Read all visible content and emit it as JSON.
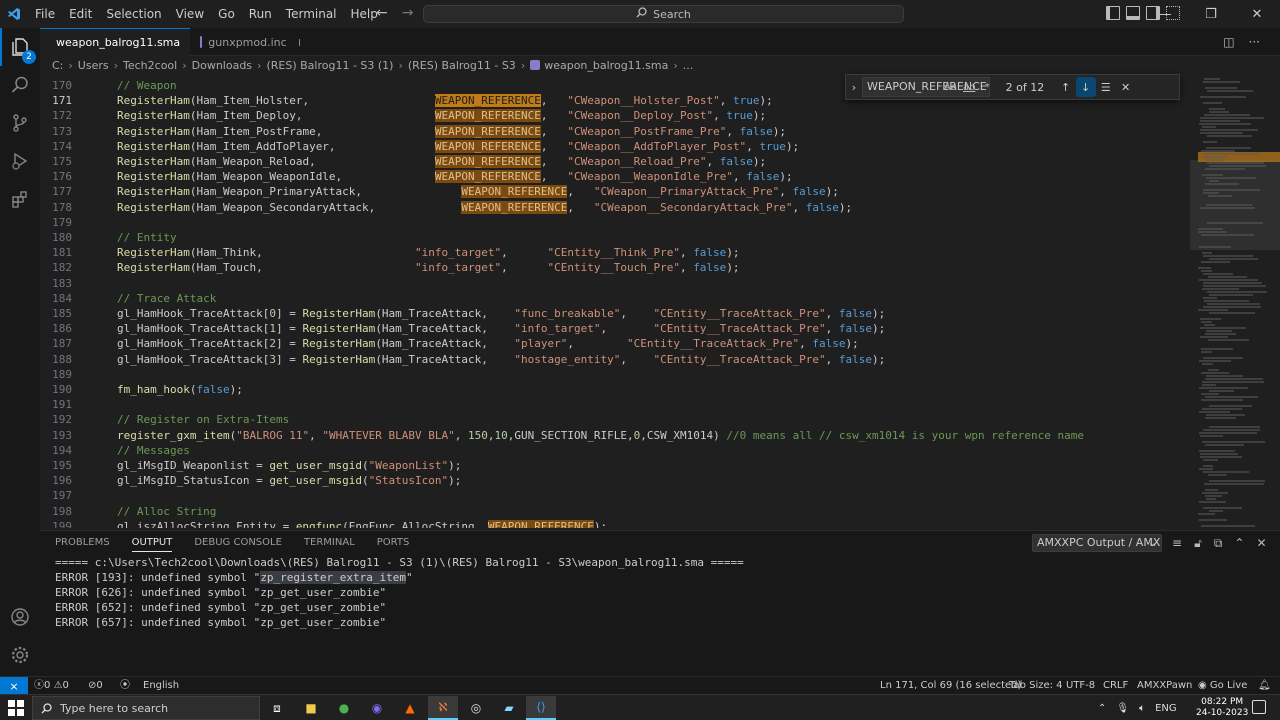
{
  "titlebar": {
    "menu": [
      "File",
      "Edit",
      "Selection",
      "View",
      "Go",
      "Run",
      "Terminal",
      "Help"
    ],
    "search_text": "Search"
  },
  "activity": {
    "scm_badge": "2"
  },
  "tabs": [
    {
      "label": "weapon_balrog11.sma",
      "active": true,
      "color": "#8c7bc8"
    },
    {
      "label": "gunxpmod.inc",
      "active": false,
      "color": "#8c7bc8"
    }
  ],
  "breadcrumb": [
    "C:",
    "Users",
    "Tech2cool",
    "Downloads",
    "(RES) Balrog11 - S3 (1)",
    "(RES) Balrog11 - S3",
    "weapon_balrog11.sma",
    "..."
  ],
  "find": {
    "value": "WEAPON_REFERENCE",
    "opt_case": "Aa",
    "opt_word": "ab",
    "opt_regex": ".*",
    "count": "2 of 12"
  },
  "editor": {
    "current_line": 171,
    "lines": [
      {
        "n": "170",
        "segs": [
          {
            "t": "// Weapon",
            "c": "c-comment"
          }
        ]
      },
      {
        "n": "171",
        "segs": [
          {
            "t": "RegisterHam",
            "c": "c-fn"
          },
          {
            "t": "(Ham_Item_Holster,                   ",
            "c": "c-id"
          },
          {
            "t": "WEAPON_REFERENCE",
            "c": "hl"
          },
          {
            "t": ",   ",
            "c": "c-id"
          },
          {
            "t": "\"CWeapon__Holster_Post\"",
            "c": "c-str"
          },
          {
            "t": ", ",
            "c": "c-id"
          },
          {
            "t": "true",
            "c": "c-kw"
          },
          {
            "t": ");",
            "c": "c-id"
          }
        ]
      },
      {
        "n": "172",
        "segs": [
          {
            "t": "RegisterHam",
            "c": "c-fn"
          },
          {
            "t": "(Ham_Item_Deploy,                    ",
            "c": "c-id"
          },
          {
            "t": "WEAPON_REFERENCE",
            "c": "hl2"
          },
          {
            "t": ",   ",
            "c": "c-id"
          },
          {
            "t": "\"CWeapon__Deploy_Post\"",
            "c": "c-str"
          },
          {
            "t": ", ",
            "c": "c-id"
          },
          {
            "t": "true",
            "c": "c-kw"
          },
          {
            "t": ");",
            "c": "c-id"
          }
        ]
      },
      {
        "n": "173",
        "segs": [
          {
            "t": "RegisterHam",
            "c": "c-fn"
          },
          {
            "t": "(Ham_Item_PostFrame,                 ",
            "c": "c-id"
          },
          {
            "t": "WEAPON_REFERENCE",
            "c": "hl2"
          },
          {
            "t": ",   ",
            "c": "c-id"
          },
          {
            "t": "\"CWeapon__PostFrame_Pre\"",
            "c": "c-str"
          },
          {
            "t": ", ",
            "c": "c-id"
          },
          {
            "t": "false",
            "c": "c-kw"
          },
          {
            "t": ");",
            "c": "c-id"
          }
        ]
      },
      {
        "n": "174",
        "segs": [
          {
            "t": "RegisterHam",
            "c": "c-fn"
          },
          {
            "t": "(Ham_Item_AddToPlayer,               ",
            "c": "c-id"
          },
          {
            "t": "WEAPON_REFERENCE",
            "c": "hl2"
          },
          {
            "t": ",   ",
            "c": "c-id"
          },
          {
            "t": "\"CWeapon__AddToPlayer_Post\"",
            "c": "c-str"
          },
          {
            "t": ", ",
            "c": "c-id"
          },
          {
            "t": "true",
            "c": "c-kw"
          },
          {
            "t": ");",
            "c": "c-id"
          }
        ]
      },
      {
        "n": "175",
        "segs": [
          {
            "t": "RegisterHam",
            "c": "c-fn"
          },
          {
            "t": "(Ham_Weapon_Reload,                  ",
            "c": "c-id"
          },
          {
            "t": "WEAPON_REFERENCE",
            "c": "hl2"
          },
          {
            "t": ",   ",
            "c": "c-id"
          },
          {
            "t": "\"CWeapon__Reload_Pre\"",
            "c": "c-str"
          },
          {
            "t": ", ",
            "c": "c-id"
          },
          {
            "t": "false",
            "c": "c-kw"
          },
          {
            "t": ");",
            "c": "c-id"
          }
        ]
      },
      {
        "n": "176",
        "segs": [
          {
            "t": "RegisterHam",
            "c": "c-fn"
          },
          {
            "t": "(Ham_Weapon_WeaponIdle,              ",
            "c": "c-id"
          },
          {
            "t": "WEAPON_REFERENCE",
            "c": "hl2"
          },
          {
            "t": ",   ",
            "c": "c-id"
          },
          {
            "t": "\"CWeapon__WeaponIdle_Pre\"",
            "c": "c-str"
          },
          {
            "t": ", ",
            "c": "c-id"
          },
          {
            "t": "false",
            "c": "c-kw"
          },
          {
            "t": ");",
            "c": "c-id"
          }
        ]
      },
      {
        "n": "177",
        "segs": [
          {
            "t": "RegisterHam",
            "c": "c-fn"
          },
          {
            "t": "(Ham_Weapon_PrimaryAttack,               ",
            "c": "c-id"
          },
          {
            "t": "WEAPON_REFERENCE",
            "c": "hl2"
          },
          {
            "t": ",   ",
            "c": "c-id"
          },
          {
            "t": "\"CWeapon__PrimaryAttack_Pre\"",
            "c": "c-str"
          },
          {
            "t": ", ",
            "c": "c-id"
          },
          {
            "t": "false",
            "c": "c-kw"
          },
          {
            "t": ");",
            "c": "c-id"
          }
        ]
      },
      {
        "n": "178",
        "segs": [
          {
            "t": "RegisterHam",
            "c": "c-fn"
          },
          {
            "t": "(Ham_Weapon_SecondaryAttack,             ",
            "c": "c-id"
          },
          {
            "t": "WEAPON_REFERENCE",
            "c": "hl2"
          },
          {
            "t": ",   ",
            "c": "c-id"
          },
          {
            "t": "\"CWeapon__SecondaryAttack_Pre\"",
            "c": "c-str"
          },
          {
            "t": ", ",
            "c": "c-id"
          },
          {
            "t": "false",
            "c": "c-kw"
          },
          {
            "t": ");",
            "c": "c-id"
          }
        ]
      },
      {
        "n": "179",
        "segs": []
      },
      {
        "n": "180",
        "segs": [
          {
            "t": "// Entity",
            "c": "c-comment"
          }
        ]
      },
      {
        "n": "181",
        "segs": [
          {
            "t": "RegisterHam",
            "c": "c-fn"
          },
          {
            "t": "(Ham_Think,                       ",
            "c": "c-id"
          },
          {
            "t": "\"info_target\"",
            "c": "c-str"
          },
          {
            "t": ",      ",
            "c": "c-id"
          },
          {
            "t": "\"CEntity__Think_Pre\"",
            "c": "c-str"
          },
          {
            "t": ", ",
            "c": "c-id"
          },
          {
            "t": "false",
            "c": "c-kw"
          },
          {
            "t": ");",
            "c": "c-id"
          }
        ]
      },
      {
        "n": "182",
        "segs": [
          {
            "t": "RegisterHam",
            "c": "c-fn"
          },
          {
            "t": "(Ham_Touch,                       ",
            "c": "c-id"
          },
          {
            "t": "\"info_target\"",
            "c": "c-str"
          },
          {
            "t": ",      ",
            "c": "c-id"
          },
          {
            "t": "\"CEntity__Touch_Pre\"",
            "c": "c-str"
          },
          {
            "t": ", ",
            "c": "c-id"
          },
          {
            "t": "false",
            "c": "c-kw"
          },
          {
            "t": ");",
            "c": "c-id"
          }
        ]
      },
      {
        "n": "183",
        "segs": []
      },
      {
        "n": "184",
        "segs": [
          {
            "t": "// Trace Attack",
            "c": "c-comment"
          }
        ]
      },
      {
        "n": "185",
        "segs": [
          {
            "t": "gl_HamHook_TraceAttack[",
            "c": "c-id"
          },
          {
            "t": "0",
            "c": "c-num"
          },
          {
            "t": "] = ",
            "c": "c-id"
          },
          {
            "t": "RegisterHam",
            "c": "c-fn"
          },
          {
            "t": "(Ham_TraceAttack,    ",
            "c": "c-id"
          },
          {
            "t": "\"func_breakable\"",
            "c": "c-str"
          },
          {
            "t": ",    ",
            "c": "c-id"
          },
          {
            "t": "\"CEntity__TraceAttack_Pre\"",
            "c": "c-str"
          },
          {
            "t": ", ",
            "c": "c-id"
          },
          {
            "t": "false",
            "c": "c-kw"
          },
          {
            "t": ");",
            "c": "c-id"
          }
        ]
      },
      {
        "n": "186",
        "segs": [
          {
            "t": "gl_HamHook_TraceAttack[",
            "c": "c-id"
          },
          {
            "t": "1",
            "c": "c-num"
          },
          {
            "t": "] = ",
            "c": "c-id"
          },
          {
            "t": "RegisterHam",
            "c": "c-fn"
          },
          {
            "t": "(Ham_TraceAttack,    ",
            "c": "c-id"
          },
          {
            "t": "\"info_target\"",
            "c": "c-str"
          },
          {
            "t": ",       ",
            "c": "c-id"
          },
          {
            "t": "\"CEntity__TraceAttack_Pre\"",
            "c": "c-str"
          },
          {
            "t": ", ",
            "c": "c-id"
          },
          {
            "t": "false",
            "c": "c-kw"
          },
          {
            "t": ");",
            "c": "c-id"
          }
        ]
      },
      {
        "n": "187",
        "segs": [
          {
            "t": "gl_HamHook_TraceAttack[",
            "c": "c-id"
          },
          {
            "t": "2",
            "c": "c-num"
          },
          {
            "t": "] = ",
            "c": "c-id"
          },
          {
            "t": "RegisterHam",
            "c": "c-fn"
          },
          {
            "t": "(Ham_TraceAttack,    ",
            "c": "c-id"
          },
          {
            "t": "\"player\"",
            "c": "c-str"
          },
          {
            "t": ",        ",
            "c": "c-id"
          },
          {
            "t": "\"CEntity__TraceAttack_Pre\"",
            "c": "c-str"
          },
          {
            "t": ", ",
            "c": "c-id"
          },
          {
            "t": "false",
            "c": "c-kw"
          },
          {
            "t": ");",
            "c": "c-id"
          }
        ]
      },
      {
        "n": "188",
        "segs": [
          {
            "t": "gl_HamHook_TraceAttack[",
            "c": "c-id"
          },
          {
            "t": "3",
            "c": "c-num"
          },
          {
            "t": "] = ",
            "c": "c-id"
          },
          {
            "t": "RegisterHam",
            "c": "c-fn"
          },
          {
            "t": "(Ham_TraceAttack,    ",
            "c": "c-id"
          },
          {
            "t": "\"hostage_entity\"",
            "c": "c-str"
          },
          {
            "t": ",    ",
            "c": "c-id"
          },
          {
            "t": "\"CEntity__TraceAttack_Pre\"",
            "c": "c-str"
          },
          {
            "t": ", ",
            "c": "c-id"
          },
          {
            "t": "false",
            "c": "c-kw"
          },
          {
            "t": ");",
            "c": "c-id"
          }
        ]
      },
      {
        "n": "189",
        "segs": []
      },
      {
        "n": "190",
        "segs": [
          {
            "t": "fm_ham_hook",
            "c": "c-fn"
          },
          {
            "t": "(",
            "c": "c-id"
          },
          {
            "t": "false",
            "c": "c-kw"
          },
          {
            "t": ");",
            "c": "c-id"
          }
        ]
      },
      {
        "n": "191",
        "segs": []
      },
      {
        "n": "192",
        "segs": [
          {
            "t": "// Register on Extra-Items",
            "c": "c-comment"
          }
        ]
      },
      {
        "n": "193",
        "segs": [
          {
            "t": "register_gxm_item",
            "c": "c-fn"
          },
          {
            "t": "(",
            "c": "c-id"
          },
          {
            "t": "\"BALROG 11\"",
            "c": "c-str"
          },
          {
            "t": ", ",
            "c": "c-id"
          },
          {
            "t": "\"WHATEVER BLABV BLA\"",
            "c": "c-str"
          },
          {
            "t": ", ",
            "c": "c-id"
          },
          {
            "t": "150",
            "c": "c-num"
          },
          {
            "t": ",",
            "c": "c-id"
          },
          {
            "t": "10",
            "c": "c-num"
          },
          {
            "t": ",GUN_SECTION_RIFLE,",
            "c": "c-id"
          },
          {
            "t": "0",
            "c": "c-num"
          },
          {
            "t": ",CSW_XM1014) ",
            "c": "c-id"
          },
          {
            "t": "//0 means all // csw_xm1014 is your wpn reference name",
            "c": "c-comment"
          }
        ]
      },
      {
        "n": "194",
        "segs": [
          {
            "t": "// Messages",
            "c": "c-comment"
          }
        ]
      },
      {
        "n": "195",
        "segs": [
          {
            "t": "gl_iMsgID_Weaponlist = ",
            "c": "c-id"
          },
          {
            "t": "get_user_msgid",
            "c": "c-fn"
          },
          {
            "t": "(",
            "c": "c-id"
          },
          {
            "t": "\"WeaponList\"",
            "c": "c-str"
          },
          {
            "t": ");",
            "c": "c-id"
          }
        ]
      },
      {
        "n": "196",
        "segs": [
          {
            "t": "gl_iMsgID_StatusIcon = ",
            "c": "c-id"
          },
          {
            "t": "get_user_msgid",
            "c": "c-fn"
          },
          {
            "t": "(",
            "c": "c-id"
          },
          {
            "t": "\"StatusIcon\"",
            "c": "c-str"
          },
          {
            "t": ");",
            "c": "c-id"
          }
        ]
      },
      {
        "n": "197",
        "segs": []
      },
      {
        "n": "198",
        "segs": [
          {
            "t": "// Alloc String",
            "c": "c-comment"
          }
        ]
      },
      {
        "n": "199",
        "segs": [
          {
            "t": "gl_iszAllocString_Entity = ",
            "c": "c-id"
          },
          {
            "t": "engfunc",
            "c": "c-fn"
          },
          {
            "t": "(EngFunc_AllocString, ",
            "c": "c-id"
          },
          {
            "t": "WEAPON_REFERENCE",
            "c": "hl2"
          },
          {
            "t": ");",
            "c": "c-id"
          }
        ]
      }
    ]
  },
  "panel": {
    "tabs": [
      "PROBLEMS",
      "OUTPUT",
      "DEBUG CONSOLE",
      "TERMINAL",
      "PORTS"
    ],
    "active_tab": "OUTPUT",
    "channel": "AMXXPC Output / AMX",
    "output_lines": [
      "===== c:\\Users\\Tech2cool\\Downloads\\(RES) Balrog11 - S3 (1)\\(RES) Balrog11 - S3\\weapon_balrog11.sma =====",
      "ERROR [193]: undefined symbol \"",
      "ERROR [626]: undefined symbol \"zp_get_user_zombie\"",
      "ERROR [652]: undefined symbol \"zp_get_user_zombie\"",
      "ERROR [657]: undefined symbol \"zp_get_user_zombie\""
    ],
    "selected_symbol": "zp_register_extra_item",
    "line2_tail": "\""
  },
  "statusbar": {
    "errors": "0",
    "warnings": "0",
    "ports": "0",
    "language_status": "English",
    "cursor": "Ln 171, Col 69 (16 selected)",
    "tab_size": "Tab Size: 4",
    "encoding": "UTF-8",
    "eol": "CRLF",
    "language": "AMXXPawn",
    "go_live": "Go Live"
  },
  "taskbar": {
    "search_placeholder": "Type here to search",
    "lang": "ENG",
    "time": "08:22 PM",
    "date": "24-10-2023"
  }
}
